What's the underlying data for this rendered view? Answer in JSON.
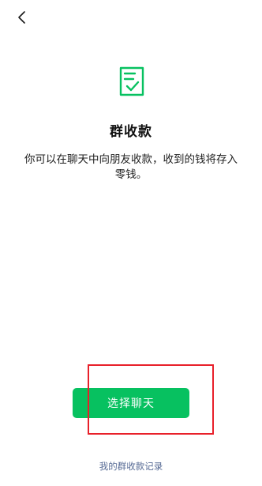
{
  "nav": {
    "back_icon": "chevron-left-icon"
  },
  "hero": {
    "icon": "document-check-icon",
    "icon_color": "#07c160",
    "title": "群收款",
    "description": "你可以在聊天中向朋友收款，收到的钱将存入零钱。"
  },
  "actions": {
    "select_chat_label": "选择聊天",
    "button_color": "#07c160",
    "records_link_label": "我的群收款记录",
    "link_color": "#576b95"
  },
  "annotation": {
    "highlight_color": "#e8202a"
  }
}
